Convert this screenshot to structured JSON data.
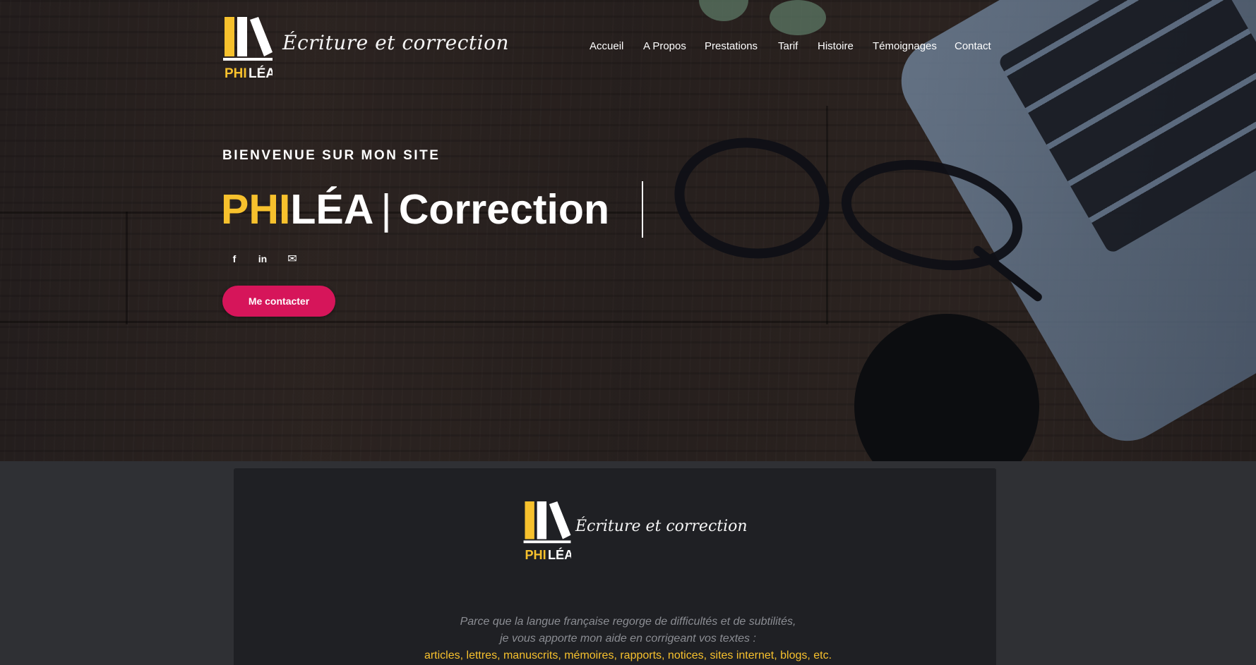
{
  "site": {
    "brand_tagline": "Écriture et correction",
    "logo": {
      "word_left": "PHI",
      "word_right": "LÉA",
      "icon": "books-logo-icon"
    },
    "colors": {
      "accent_yellow": "#f7c12d",
      "accent_pink": "#d6155a",
      "panel_bg": "#1f2024"
    }
  },
  "nav": {
    "items": [
      {
        "label": "Accueil"
      },
      {
        "label": "A Propos"
      },
      {
        "label": "Prestations"
      },
      {
        "label": "Tarif"
      },
      {
        "label": "Histoire"
      },
      {
        "label": "Témoignages"
      },
      {
        "label": "Contact"
      }
    ]
  },
  "hero": {
    "welcome": "BIENVENUE SUR MON SITE",
    "headline_yellow": "PHI",
    "headline_white": "LÉA",
    "headline_separator": "|",
    "headline_rest": "Correction",
    "social": [
      {
        "icon": "facebook-icon",
        "glyph": "f"
      },
      {
        "icon": "linkedin-icon",
        "glyph": "in"
      },
      {
        "icon": "mail-icon",
        "glyph": "✉"
      }
    ],
    "cta_label": "Me contacter"
  },
  "panel": {
    "tagline": "Écriture et correction",
    "intro_line1": "Parce que la langue française regorge de difficultés et de subtilités,",
    "intro_line2": "je vous apporte mon aide en corrigeant vos textes :",
    "intro_line3": "articles, lettres, manuscrits, mémoires, rapports, notices, sites internet, blogs, etc."
  }
}
